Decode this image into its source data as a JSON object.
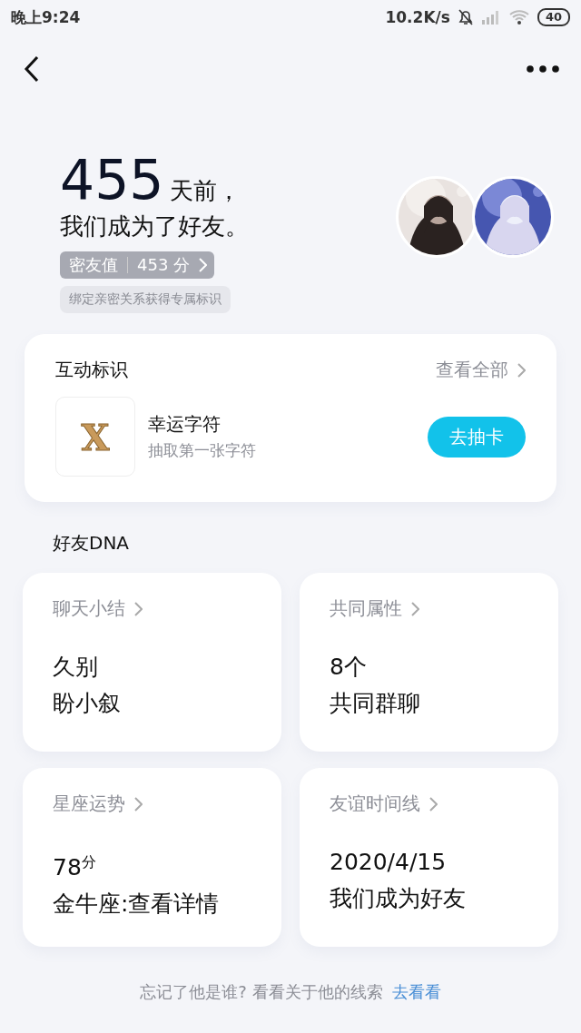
{
  "status_bar": {
    "time": "晚上9:24",
    "speed": "10.2K/s",
    "battery": "40"
  },
  "hero": {
    "days": "455",
    "days_suffix": "天前，",
    "subtitle": "我们成为了好友。",
    "score_label": "密友值",
    "score_value": "453 分",
    "tip": "绑定亲密关系获得专属标识"
  },
  "interaction_card": {
    "title": "互动标识",
    "view_all": "查看全部",
    "item": {
      "letter": "X",
      "name": "幸运字符",
      "description": "抽取第一张字符",
      "button": "去抽卡"
    }
  },
  "dna_section": {
    "title": "好友DNA",
    "tiles": [
      {
        "title": "聊天小结",
        "line_1": "久别",
        "line_2": "盼小叙"
      },
      {
        "title": "共同属性",
        "line_1": "8个",
        "line_2": "共同群聊"
      },
      {
        "title": "星座运势",
        "line_1": "78$^{分}$",
        "line_2": "金牛座:查看详情"
      },
      {
        "title": "友谊时间线",
        "line_1": "2020/4/15",
        "line_2": "我们成为好友"
      }
    ]
  },
  "footer": {
    "text": "忘记了他是谁? 看看关于他的线索",
    "link": "去看看"
  }
}
